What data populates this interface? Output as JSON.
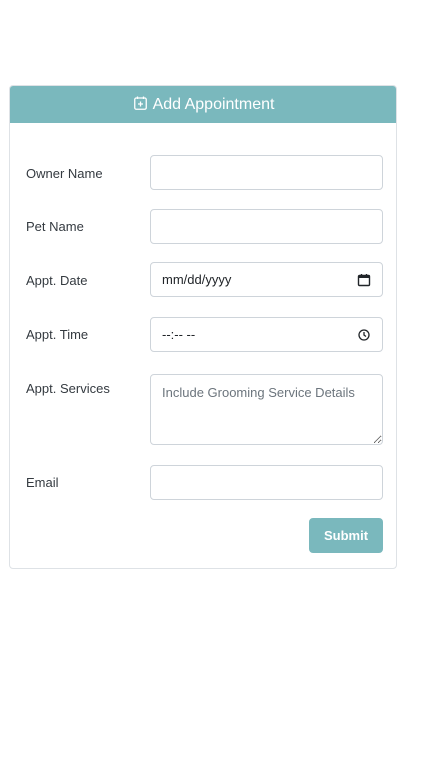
{
  "form": {
    "title": "Add Appointment",
    "title_icon": "calendar-plus-icon",
    "accent_color": "#7ab8bd",
    "fields": {
      "owner_name": {
        "label": "Owner Name",
        "value": ""
      },
      "pet_name": {
        "label": "Pet Name",
        "value": ""
      },
      "appt_date": {
        "label": "Appt. Date",
        "display": "mm/dd/yyyy",
        "icon": "calendar-icon"
      },
      "appt_time": {
        "label": "Appt. Time",
        "display": "--:-- --",
        "icon": "clock-icon"
      },
      "appt_services": {
        "label": "Appt. Services",
        "placeholder": "Include Grooming Service Details"
      },
      "email": {
        "label": "Email",
        "value": ""
      }
    },
    "submit_label": "Submit"
  }
}
